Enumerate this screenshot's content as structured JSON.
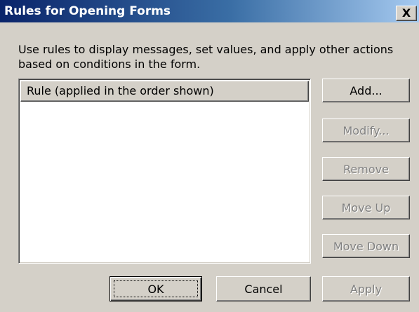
{
  "dialog": {
    "title": "Rules for Opening Forms",
    "close_label": "X",
    "description": "Use rules to display messages, set values, and apply other actions based on conditions in the form."
  },
  "rules_list": {
    "column_header": "Rule (applied in the order shown)",
    "items": []
  },
  "side_buttons": {
    "add": {
      "label": "Add...",
      "enabled": true
    },
    "modify": {
      "label": "Modify...",
      "enabled": false
    },
    "remove": {
      "label": "Remove",
      "enabled": false
    },
    "move_up": {
      "label": "Move Up",
      "enabled": false
    },
    "move_down": {
      "label": "Move Down",
      "enabled": false
    }
  },
  "footer_buttons": {
    "ok": {
      "label": "OK",
      "enabled": true,
      "default": true
    },
    "cancel": {
      "label": "Cancel",
      "enabled": true
    },
    "apply": {
      "label": "Apply",
      "enabled": false
    }
  },
  "colors": {
    "titlebar_start": "#0a246a",
    "titlebar_end": "#a6caf0",
    "face": "#d4d0c8",
    "disabled_text": "#808080"
  }
}
